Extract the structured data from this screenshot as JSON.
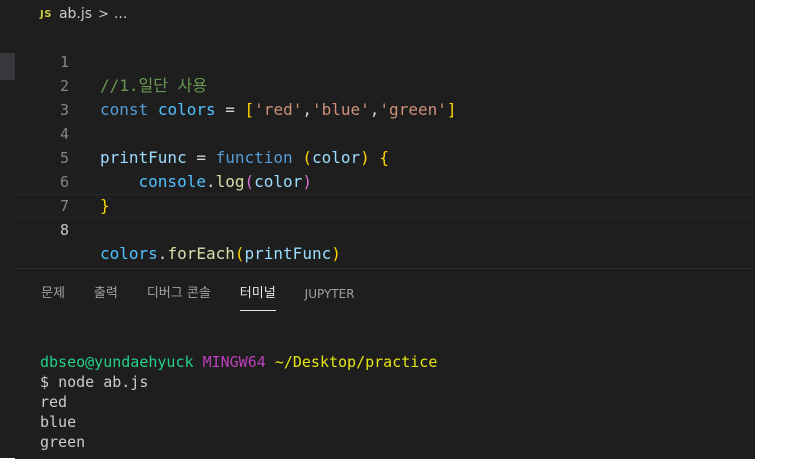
{
  "breadcrumb": {
    "file_icon": "JS",
    "file": "ab.js",
    "separator": ">",
    "ellipsis": "..."
  },
  "editor": {
    "lines": [
      {
        "number": "1",
        "text": "//1.일단 사용"
      },
      {
        "number": "2",
        "text": "const colors = ['red','blue','green']"
      },
      {
        "number": "3",
        "text": ""
      },
      {
        "number": "4",
        "text": "printFunc = function (color) {"
      },
      {
        "number": "5",
        "text": "    console.log(color)"
      },
      {
        "number": "6",
        "text": "}"
      },
      {
        "number": "7",
        "text": ""
      },
      {
        "number": "8",
        "text": "colors.forEach(printFunc)"
      }
    ],
    "active_line": "8"
  },
  "panel": {
    "tabs": [
      "문제",
      "출력",
      "디버그 콘솔",
      "터미널",
      "JUPYTER"
    ],
    "active_tab": "터미널"
  },
  "terminal": {
    "user": "dbseo@yundaehyuck",
    "host": "MINGW64",
    "path": "~/Desktop/practice",
    "prompt": "$",
    "command": "node ab.js",
    "output": [
      "red",
      "blue",
      "green"
    ]
  },
  "colors": {
    "editor_bg": "#1e1e1e",
    "comment": "#6a9955",
    "keyword": "#569cd6",
    "string": "#ce9178",
    "function": "#dcdcaa",
    "terminal_user": "#23d18b",
    "terminal_host": "#bc3fbc",
    "terminal_path": "#e5e510"
  }
}
